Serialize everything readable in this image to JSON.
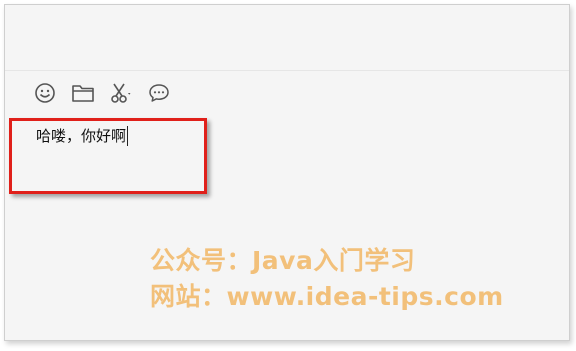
{
  "toolbar": {
    "icons": [
      "smiley-icon",
      "folder-icon",
      "scissors-icon",
      "chat-bubble-icon"
    ]
  },
  "input": {
    "value": "哈喽，你好啊"
  },
  "watermark": {
    "line1": "公众号：Java入门学习",
    "line2": "网站：www.idea-tips.com"
  },
  "colors": {
    "highlight_border": "#e0201a",
    "watermark": "#f2c07a",
    "background": "#f5f5f5"
  }
}
